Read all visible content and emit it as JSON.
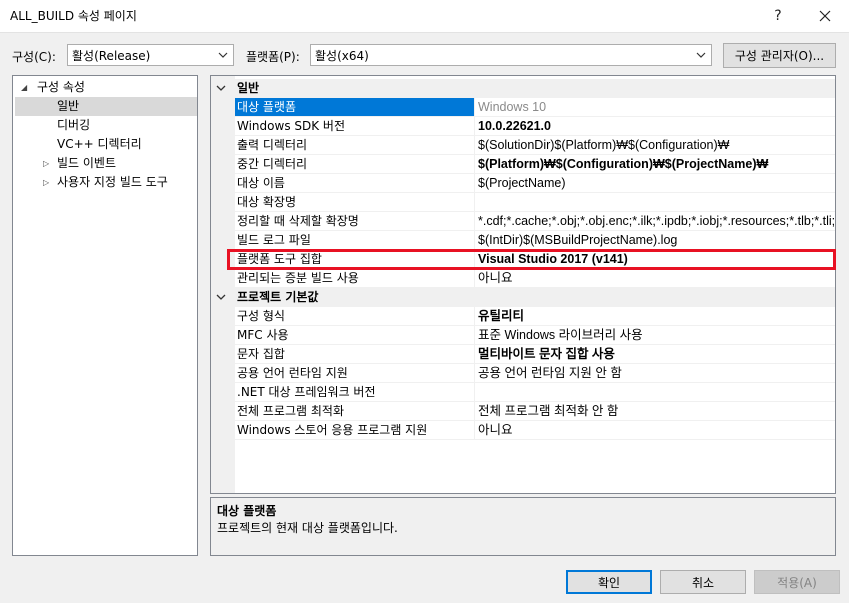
{
  "window": {
    "title": "ALL_BUILD 속성 페이지",
    "help_glyph": "?",
    "close_icon": "close-icon"
  },
  "toolbar": {
    "config_label": "구성(C):",
    "config_value": "활성(Release)",
    "platform_label": "플랫폼(P):",
    "platform_value": "활성(x64)",
    "config_manager_label": "구성 관리자(O)..."
  },
  "tree": {
    "root_label": "구성 속성",
    "items": [
      {
        "label": "일반",
        "selected": true
      },
      {
        "label": "디버깅"
      },
      {
        "label": "VC++ 디렉터리"
      },
      {
        "label": "빌드 이벤트",
        "expandable": true
      },
      {
        "label": "사용자 지정 빌드 도구",
        "expandable": true
      }
    ]
  },
  "grid": {
    "categories": [
      {
        "name": "일반",
        "rows": [
          {
            "name": "대상 플랫폼",
            "value": "Windows 10",
            "selected": true,
            "gray": true
          },
          {
            "name": "Windows SDK 버전",
            "value": "10.0.22621.0",
            "bold": true
          },
          {
            "name": "출력 디렉터리",
            "value": "$(SolutionDir)$(Platform)₩$(Configuration)₩"
          },
          {
            "name": "중간 디렉터리",
            "value": "$(Platform)₩$(Configuration)₩$(ProjectName)₩",
            "bold": true
          },
          {
            "name": "대상 이름",
            "value": "$(ProjectName)"
          },
          {
            "name": "대상 확장명",
            "value": ""
          },
          {
            "name": "정리할 때 삭제할 확장명",
            "value": "*.cdf;*.cache;*.obj;*.obj.enc;*.ilk;*.ipdb;*.iobj;*.resources;*.tlb;*.tli;*.tl"
          },
          {
            "name": "빌드 로그 파일",
            "value": "$(IntDir)$(MSBuildProjectName).log"
          },
          {
            "name": "플랫폼 도구 집합",
            "value": "Visual Studio 2017 (v141)",
            "bold": true,
            "highlighted": true
          },
          {
            "name": "관리되는 증분 빌드 사용",
            "value": "아니요"
          }
        ]
      },
      {
        "name": "프로젝트 기본값",
        "rows": [
          {
            "name": "구성 형식",
            "value": "유틸리티",
            "bold": true
          },
          {
            "name": "MFC 사용",
            "value": "표준 Windows 라이브러리 사용"
          },
          {
            "name": "문자 집합",
            "value": "멀티바이트 문자 집합 사용",
            "bold": true
          },
          {
            "name": "공용 언어 런타임 지원",
            "value": "공용 언어 런타임 지원 안 함"
          },
          {
            "name": ".NET 대상 프레임워크 버전",
            "value": ""
          },
          {
            "name": "전체 프로그램 최적화",
            "value": "전체 프로그램 최적화 안 함"
          },
          {
            "name": "Windows 스토어 응용 프로그램 지원",
            "value": "아니요"
          }
        ]
      }
    ]
  },
  "description": {
    "title": "대상 플랫폼",
    "text": "프로젝트의 현재 대상 플랫폼입니다."
  },
  "buttons": {
    "ok": "확인",
    "cancel": "취소",
    "apply": "적용(A)"
  },
  "colors": {
    "selection": "#0078d7",
    "highlight_box": "#e81123"
  }
}
